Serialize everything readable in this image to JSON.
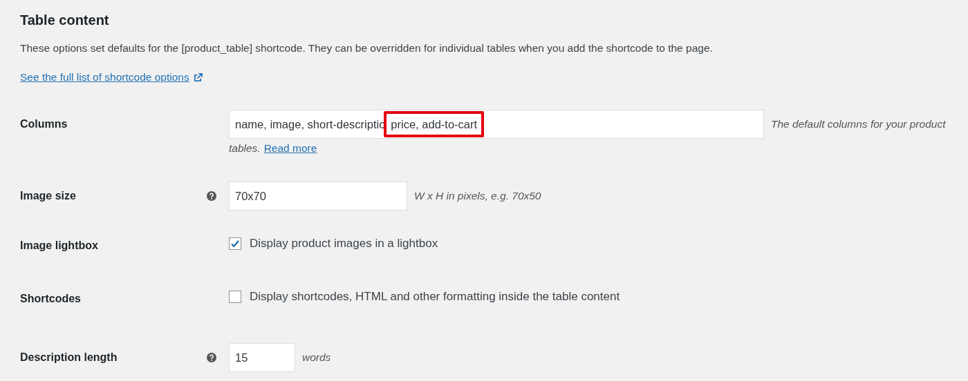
{
  "section": {
    "title": "Table content",
    "intro": "These options set defaults for the [product_table] shortcode. They can be overridden for individual tables when you add the shortcode to the page.",
    "link": "See the full list of shortcode options"
  },
  "settings": [
    {
      "kind": "columns",
      "label": "Columns",
      "value": "name, image, short-descriptio",
      "highlighted_value": "price, add-to-cart",
      "description_lines": [
        "The default columns for your product",
        "tables."
      ],
      "link": "Read more"
    },
    {
      "kind": "text",
      "label": "Image size",
      "help": true,
      "value": "70x70",
      "description": "W x H in pixels, e.g. 70x50"
    },
    {
      "kind": "checkbox",
      "label": "Image lightbox",
      "checked": true,
      "option": "Display product images in a lightbox"
    },
    {
      "kind": "checkbox",
      "label": "Shortcodes",
      "checked": false,
      "option": "Display shortcodes, HTML and other formatting inside the table content"
    },
    {
      "kind": "number",
      "label": "Description length",
      "help": true,
      "value": "15",
      "description": "words"
    }
  ]
}
